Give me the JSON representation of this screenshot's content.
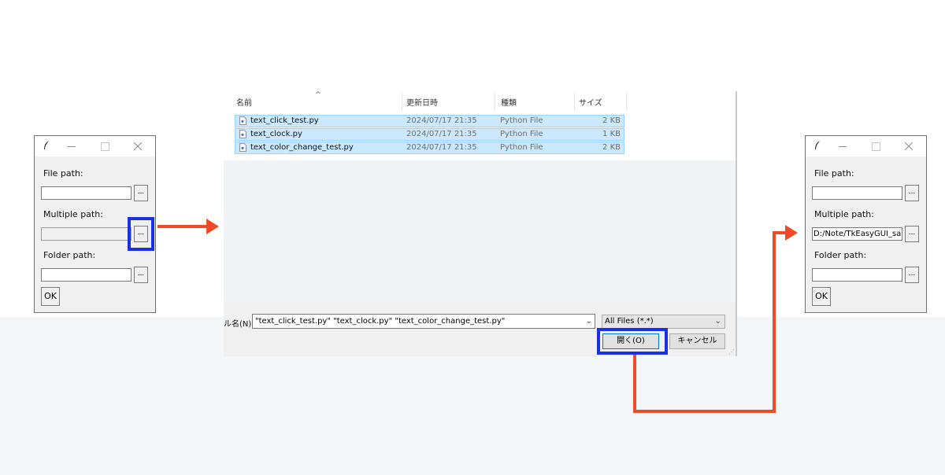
{
  "left_window": {
    "labels": {
      "file": "File path:",
      "multiple": "Multiple path:",
      "folder": "Folder path:"
    },
    "values": {
      "file": "",
      "multiple": "",
      "folder": ""
    },
    "browse_label": "...",
    "ok_label": "OK"
  },
  "right_window": {
    "labels": {
      "file": "File path:",
      "multiple": "Multiple path:",
      "folder": "Folder path:"
    },
    "values": {
      "file": "",
      "multiple": "D:/Note/TkEasyGUI_sar",
      "folder": ""
    },
    "browse_label": "...",
    "ok_label": "OK"
  },
  "dialog": {
    "columns": {
      "name": "名前",
      "date": "更新日時",
      "type": "種類",
      "size": "サイズ"
    },
    "files": [
      {
        "name": "text_click_test.py",
        "date": "2024/07/17 21:35",
        "type": "Python File",
        "size": "2 KB"
      },
      {
        "name": "text_clock.py",
        "date": "2024/07/17 21:35",
        "type": "Python File",
        "size": "1 KB"
      },
      {
        "name": "text_color_change_test.py",
        "date": "2024/07/17 21:35",
        "type": "Python File",
        "size": "2 KB"
      }
    ],
    "filename_label": "ル名(N):",
    "filename_value": "\"text_click_test.py\" \"text_clock.py\" \"text_color_change_test.py\"",
    "filetype_value": "All Files (*.*)",
    "open_label": "開く(O)",
    "cancel_label": "キャンセル"
  },
  "colors": {
    "highlight_box": "#1a2fe8",
    "arrow": "#f04a26",
    "selection": "#cce8ff",
    "background_band": "#f3f7f9"
  },
  "icons": {
    "title_bar": [
      "feather-icon",
      "minimize-icon",
      "maximize-icon",
      "close-icon"
    ],
    "file_rows": "python-file-icon",
    "sort": "sort-ascending-icon",
    "dropdown": "chevron-down-icon"
  }
}
